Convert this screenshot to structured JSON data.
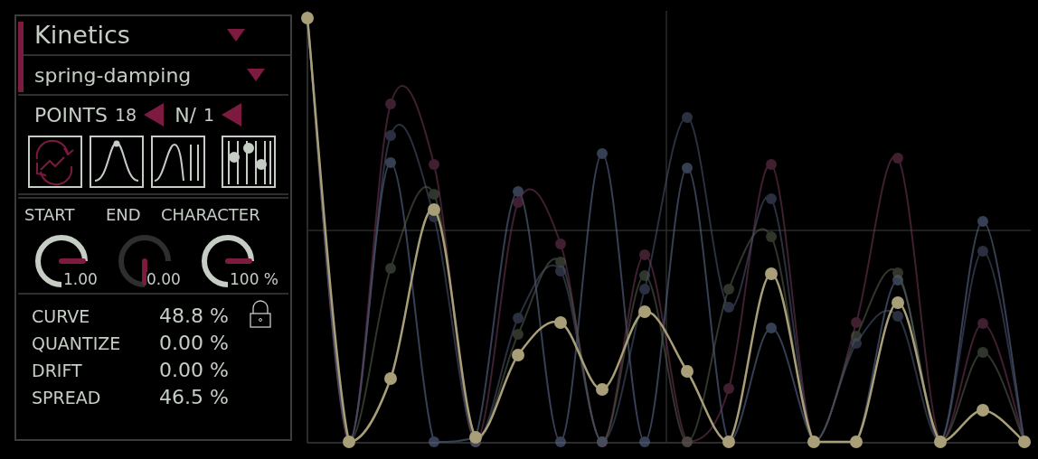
{
  "preset": {
    "title": "Kinetics"
  },
  "mode": {
    "value": "spring-damping"
  },
  "points": {
    "label": "POINTS",
    "value": "18"
  },
  "divisor": {
    "label": "N/",
    "value": "1"
  },
  "tools": [
    {
      "kind": "random",
      "selected": true
    },
    {
      "kind": "bell",
      "selected": false
    },
    {
      "kind": "ramp",
      "selected": false
    },
    {
      "kind": "sliders",
      "selected": false
    }
  ],
  "knobs": [
    {
      "label": "START",
      "value": "1.00"
    },
    {
      "label": "END",
      "value": "0.00"
    },
    {
      "label": "CHARACTER",
      "value": "100 %"
    }
  ],
  "params": [
    {
      "label": "CURVE",
      "value": "48.8 %"
    },
    {
      "label": "QUANTIZE",
      "value": "0.00 %"
    },
    {
      "label": "DRIFT",
      "value": "0.00 %"
    },
    {
      "label": "SPREAD",
      "value": "46.5 %"
    }
  ]
}
